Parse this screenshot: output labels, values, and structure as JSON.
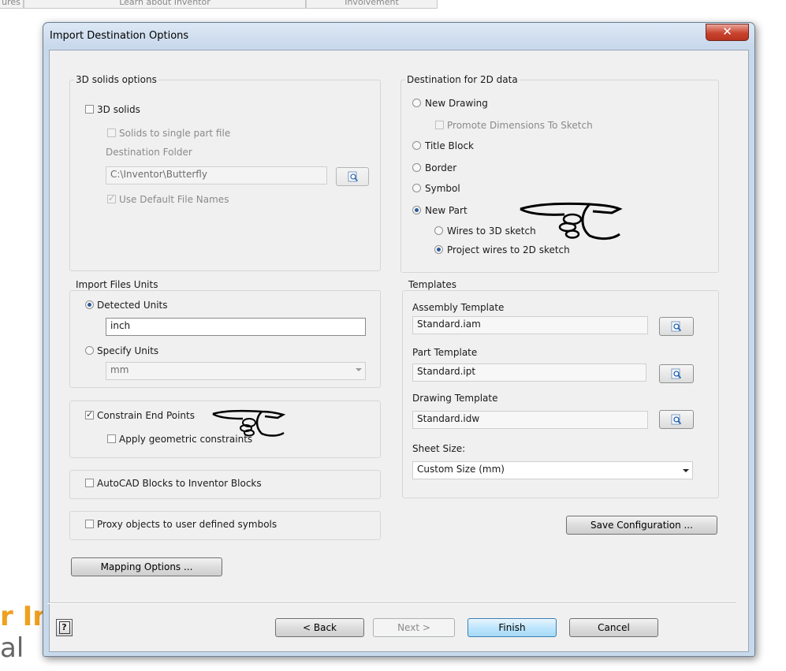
{
  "background": {
    "tabs": [
      "ures",
      "Learn about Inventor",
      "Involvement"
    ],
    "logo_line1": "r In",
    "logo_line2": "al"
  },
  "dialog": {
    "title": "Import Destination Options",
    "close_glyph": "✕"
  },
  "solids": {
    "group_label": "3D solids options",
    "solids_check": {
      "label": "3D solids",
      "checked": false
    },
    "single_part": {
      "label": "Solids to single part file",
      "checked": false
    },
    "dest_folder_label": "Destination Folder",
    "dest_folder_value": "C:\\Inventor\\Butterfly",
    "default_names": {
      "label": "Use Default File Names",
      "checked": true
    }
  },
  "units": {
    "group_label": "Import Files Units",
    "detected": {
      "label": "Detected Units",
      "selected": true
    },
    "detected_value": "inch",
    "specify": {
      "label": "Specify Units",
      "selected": false
    },
    "specify_value": "mm"
  },
  "constraints": {
    "end_points": {
      "label": "Constrain End Points",
      "checked": true
    },
    "geometric": {
      "label": "Apply geometric constraints",
      "checked": false
    }
  },
  "blocks": {
    "label": "AutoCAD Blocks to Inventor Blocks",
    "checked": false
  },
  "proxy": {
    "label": "Proxy objects to user defined symbols",
    "checked": false
  },
  "mapping_button": "Mapping Options ...",
  "destination2d": {
    "group_label": "Destination for 2D data",
    "new_drawing": {
      "label": "New Drawing",
      "selected": false
    },
    "promote_dims": {
      "label": "Promote Dimensions To Sketch",
      "checked": false
    },
    "title_block": {
      "label": "Title Block",
      "selected": false
    },
    "border": {
      "label": "Border",
      "selected": false
    },
    "symbol": {
      "label": "Symbol",
      "selected": false
    },
    "new_part": {
      "label": "New Part",
      "selected": true
    },
    "wires_3d": {
      "label": "Wires to 3D sketch",
      "selected": false
    },
    "project_2d": {
      "label": "Project wires to 2D sketch",
      "selected": true
    }
  },
  "templates": {
    "group_label": "Templates",
    "assembly_label": "Assembly Template",
    "assembly_value": "Standard.iam",
    "part_label": "Part Template",
    "part_value": "Standard.ipt",
    "drawing_label": "Drawing Template",
    "drawing_value": "Standard.idw",
    "sheet_label": "Sheet Size:",
    "sheet_value": "Custom Size (mm)"
  },
  "save_config_button": "Save Configuration ...",
  "footer": {
    "help_glyph": "?",
    "back": "< Back",
    "next": "Next >",
    "finish": "Finish",
    "cancel": "Cancel"
  },
  "check_glyph": "✓",
  "colors": {
    "accent": "#2a5a9a",
    "close": "#c9442e",
    "focus_border": "#3c7fb1"
  }
}
